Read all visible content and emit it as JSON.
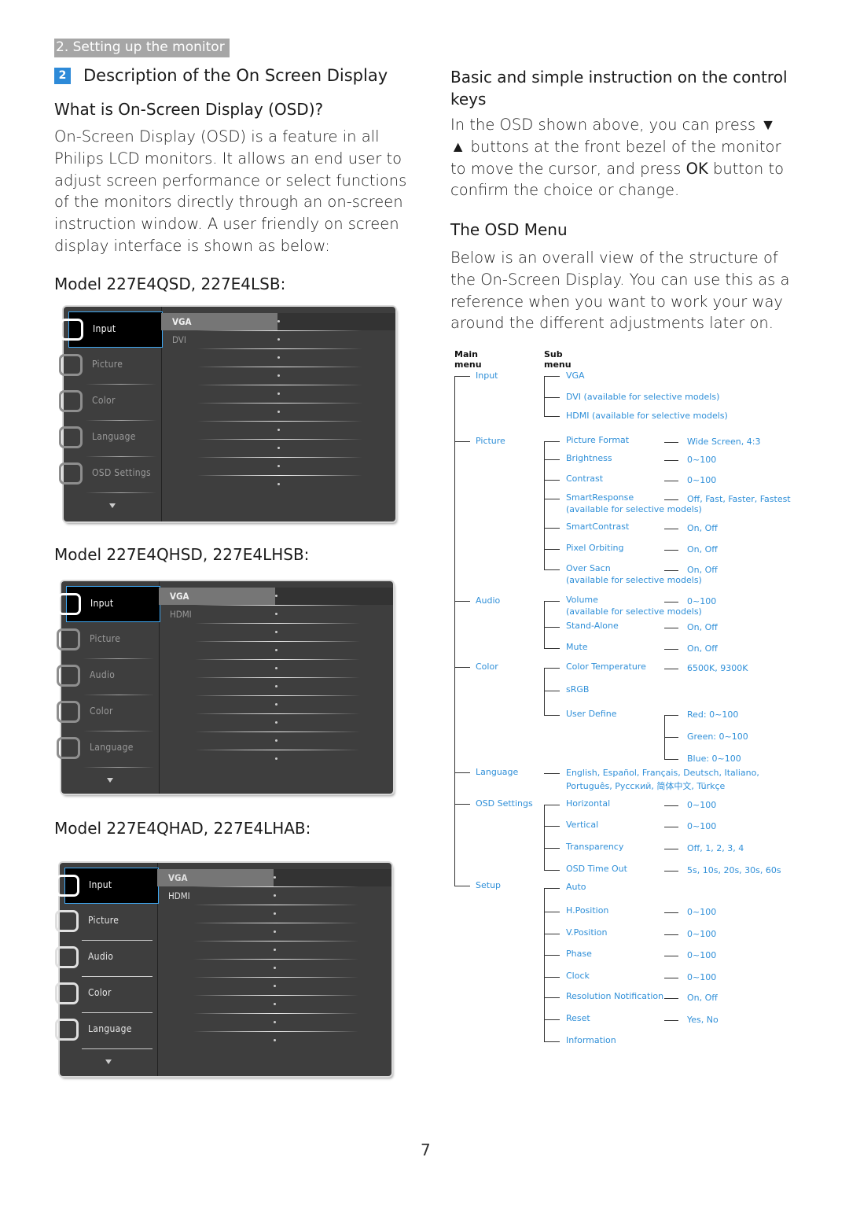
{
  "section_tag": "2. Setting up the monitor",
  "heading": {
    "badge": "2",
    "title": "Description of the On Screen Display"
  },
  "left": {
    "what_is_title": "What is On-Screen Display (OSD)?",
    "what_is_lines": [
      "On-Screen Display (OSD) is a feature in all",
      "Philips LCD monitors. It allows an end user to",
      "adjust screen performance or select functions",
      "of the monitors directly through an on-screen",
      "instruction window. A user friendly on screen",
      "display interface is shown as below:"
    ],
    "models": [
      {
        "title": "Model 227E4QSD, 227E4LSB:",
        "menu": [
          "Input",
          "Picture",
          "Color",
          "Language",
          "OSD Settings"
        ],
        "icons": [
          "input-icon",
          "picture-icon",
          "color-icon",
          "language-icon",
          "osd-settings-icon"
        ],
        "submenu": [
          "VGA",
          "DVI"
        ],
        "selected_menu": "Input",
        "selected_sub": "VGA"
      },
      {
        "title": "Model 227E4QHSD, 227E4LHSB:",
        "menu": [
          "Input",
          "Picture",
          "Audio",
          "Color",
          "Language"
        ],
        "icons": [
          "input-icon",
          "picture-icon",
          "audio-icon",
          "color-icon",
          "language-icon"
        ],
        "submenu": [
          "VGA",
          "HDMI"
        ],
        "selected_menu": "Input",
        "selected_sub": "VGA"
      },
      {
        "title": "Model 227E4QHAD, 227E4LHAB:",
        "menu": [
          "Input",
          "Picture",
          "Audio",
          "Color",
          "Language"
        ],
        "icons": [
          "input-icon",
          "picture-icon",
          "audio-icon",
          "color-icon",
          "language-icon"
        ],
        "submenu": [
          "VGA",
          "HDMI"
        ],
        "selected_menu": "Input",
        "selected_sub": "VGA"
      }
    ]
  },
  "right": {
    "control_title_lines": [
      "Basic and simple instruction on the control",
      "keys"
    ],
    "control_lines": [
      "In the OSD shown above, you can press ▼",
      "▲ buttons at the front bezel of the monitor",
      "to move the cursor, and press OK button to",
      "confirm the choice or change."
    ],
    "osd_menu_title": "The OSD Menu",
    "osd_menu_lines": [
      "Below is an overall view of the structure of",
      "the On-Screen Display. You can use this as a",
      "reference when you want to work your way",
      "around the different adjustments later on."
    ],
    "tree": {
      "main_header": "Main menu",
      "sub_header": "Sub menu",
      "main_items": [
        "Input",
        "Picture",
        "Audio",
        "Color",
        "Language",
        "OSD Settings",
        "Setup"
      ],
      "input": [
        "VGA",
        "DVI (available for selective models)",
        "HDMI (available for selective models)"
      ],
      "picture": [
        {
          "name": "Picture Format",
          "value": "Wide Screen, 4:3"
        },
        {
          "name": "Brightness",
          "value": "0~100"
        },
        {
          "name": "Contrast",
          "value": "0~100"
        },
        {
          "name": "SmartResponse",
          "note": "(available for selective models)",
          "value": "Off, Fast, Faster, Fastest"
        },
        {
          "name": "SmartContrast",
          "value": "On, Off"
        },
        {
          "name": "Pixel Orbiting",
          "value": "On, Off"
        },
        {
          "name": "Over Sacn",
          "note": "(available for selective models)",
          "value": "On, Off"
        }
      ],
      "audio": [
        {
          "name": "Volume",
          "note": "(available for selective models)",
          "value": "0~100"
        },
        {
          "name": "Stand-Alone",
          "value": "On, Off"
        },
        {
          "name": "Mute",
          "value": "On, Off"
        }
      ],
      "color": [
        {
          "name": "Color Temperature",
          "value": "6500K, 9300K"
        },
        {
          "name": "sRGB"
        },
        {
          "name": "User Define"
        }
      ],
      "user_define": [
        "Red: 0~100",
        "Green: 0~100",
        "Blue: 0~100"
      ],
      "language_lines": [
        "English, Español, Français, Deutsch, Italiano,",
        "Português, Русский, 简体中文, Türkçe"
      ],
      "osd_settings": [
        {
          "name": "Horizontal",
          "value": "0~100"
        },
        {
          "name": "Vertical",
          "value": "0~100"
        },
        {
          "name": "Transparency",
          "value": "Off, 1, 2, 3, 4"
        },
        {
          "name": "OSD Time Out",
          "value": "5s, 10s, 20s, 30s, 60s"
        }
      ],
      "setup": [
        {
          "name": "Auto"
        },
        {
          "name": "H.Position",
          "value": "0~100"
        },
        {
          "name": "V.Position",
          "value": "0~100"
        },
        {
          "name": "Phase",
          "value": "0~100"
        },
        {
          "name": "Clock",
          "value": "0~100"
        },
        {
          "name": "Resolution Notification",
          "value": "On, Off"
        },
        {
          "name": "Reset",
          "value": "Yes, No"
        },
        {
          "name": "Information"
        }
      ]
    }
  },
  "page_number": "7",
  "colors": {
    "link_blue": "#2f8fd8",
    "badge_blue": "#2d8ad8",
    "section_gray": "#a6a6a6",
    "osd_bg": "#3e3e3e",
    "osd_select_border": "#3fa9f5"
  }
}
